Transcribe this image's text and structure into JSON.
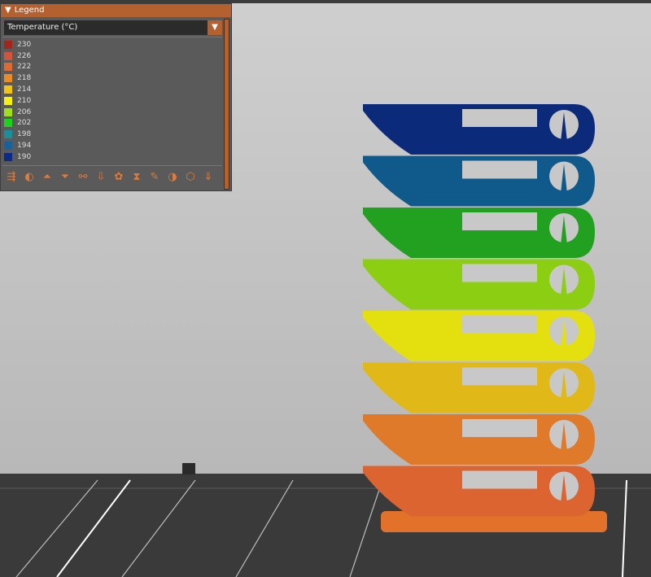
{
  "legend": {
    "title": "Legend",
    "dropdown_value": "Temperature (°C)",
    "items": [
      {
        "label": "230",
        "color": "#a3261b"
      },
      {
        "label": "226",
        "color": "#d2543a"
      },
      {
        "label": "222",
        "color": "#df6a2f"
      },
      {
        "label": "218",
        "color": "#ea8b26"
      },
      {
        "label": "214",
        "color": "#f2c414"
      },
      {
        "label": "210",
        "color": "#f5f00c"
      },
      {
        "label": "206",
        "color": "#9fe01a"
      },
      {
        "label": "202",
        "color": "#1ad31a"
      },
      {
        "label": "198",
        "color": "#1a8f9a"
      },
      {
        "label": "194",
        "color": "#17619e"
      },
      {
        "label": "190",
        "color": "#0c2a8a"
      }
    ],
    "tools": [
      "shells-icon",
      "tool-marker-icon",
      "retractions-icon",
      "deretractions-icon",
      "seams-icon",
      "tool-changes-icon",
      "color-changes-icon",
      "pause-icon",
      "custom-gcode-icon",
      "center-of-gravity-icon",
      "bounding-box-icon",
      "export-toolpaths-icon"
    ]
  },
  "tower_colors": [
    "#0c2a7a",
    "#0f5a8a",
    "#22a020",
    "#8ccf12",
    "#e4e010",
    "#e0b818",
    "#df7a2a",
    "#dc6430"
  ]
}
